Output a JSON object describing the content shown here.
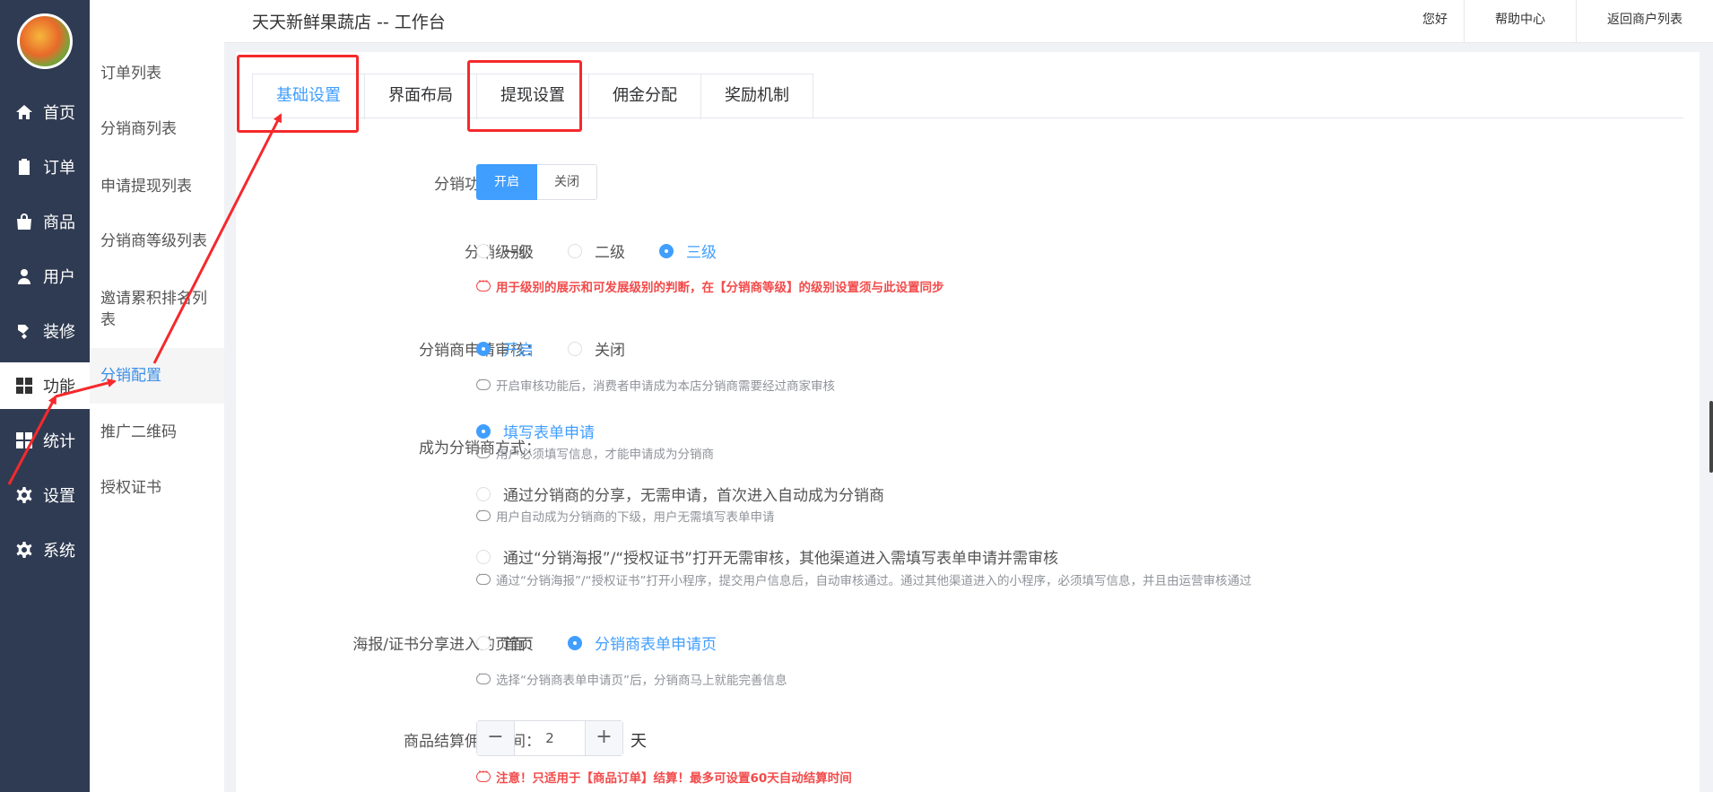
{
  "header": {
    "store_title": "天天新鲜果蔬店 -- 工作台",
    "links": [
      "您好",
      "帮助中心",
      "返回商户列表"
    ]
  },
  "nav": {
    "items": [
      {
        "label": "首页",
        "icon": "home-icon"
      },
      {
        "label": "订单",
        "icon": "clipboard-icon"
      },
      {
        "label": "商品",
        "icon": "shopping-bag-icon"
      },
      {
        "label": "用户",
        "icon": "user-icon"
      },
      {
        "label": "装修",
        "icon": "paint-roller-icon"
      },
      {
        "label": "功能",
        "icon": "grid-icon"
      },
      {
        "label": "统计",
        "icon": "chart-grid-icon"
      },
      {
        "label": "设置",
        "icon": "gear-icon"
      },
      {
        "label": "系统",
        "icon": "cog-icon"
      }
    ],
    "active_index": 5
  },
  "subnav": {
    "items": [
      "订单列表",
      "分销商列表",
      "申请提现列表",
      "分销商等级列表",
      "邀请累积排名列表",
      "分销配置",
      "推广二维码",
      "授权证书"
    ],
    "active_index": 5
  },
  "tabs": {
    "items": [
      "基础设置",
      "界面布局",
      "提现设置",
      "佣金分配",
      "奖励机制"
    ],
    "active_index": 0
  },
  "form": {
    "status": {
      "label": "分销功能状态：",
      "on": "开启",
      "off": "关闭",
      "selected": "on"
    },
    "level": {
      "label": "分销级别：",
      "options": [
        "一级",
        "二级",
        "三级"
      ],
      "selected": 2,
      "hint": "用于级别的展示和可发展级别的判断，在【分销商等级】的级别设置须与此设置同步"
    },
    "review": {
      "label": "分销商申请审核：",
      "options": [
        "开启",
        "关闭"
      ],
      "selected": 0,
      "hint": "开启审核功能后，消费者申请成为本店分销商需要经过商家审核"
    },
    "become": {
      "label": "成为分销商方式：",
      "options": [
        {
          "text": "填写表单申请",
          "hint": "用户必须填写信息，才能申请成为分销商"
        },
        {
          "text": "通过分销商的分享，无需申请，首次进入自动成为分销商",
          "hint": "用户自动成为分销商的下级，用户无需填写表单申请"
        },
        {
          "text": "通过“分销海报”/“授权证书”打开无需审核，其他渠道进入需填写表单申请并需审核",
          "hint": "通过“分销海报”/“授权证书”打开小程序，提交用户信息后，自动审核通过。通过其他渠道进入的小程序，必须填写信息，并且由运营审核通过"
        }
      ],
      "selected": 0
    },
    "share_page": {
      "label": "海报/证书分享进入的页面：",
      "options": [
        "首页",
        "分销商表单申请页"
      ],
      "selected": 1,
      "hint": "选择“分销商表单申请页”后，分销商马上就能完善信息"
    },
    "settle": {
      "label": "商品结算佣金时间：",
      "minus": "−",
      "value": "2",
      "plus": "+",
      "unit": "天",
      "hint": "注意！只适用于【商品订单】结算！最多可设置60天自动结算时间"
    }
  },
  "colors": {
    "nav_bg": "#2f3b52",
    "accent": "#409eff",
    "annotation": "#f5292c",
    "warning": "#f24b4b"
  }
}
